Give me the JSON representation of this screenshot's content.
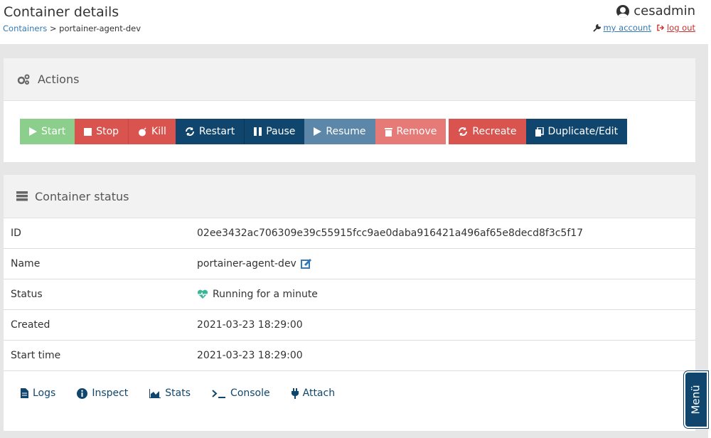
{
  "header": {
    "title": "Container details",
    "breadcrumb": {
      "parent": "Containers",
      "separator": ">",
      "current": "portainer-agent-dev"
    },
    "user": {
      "name": "cesadmin",
      "my_account": "my account",
      "log_out": "log out"
    }
  },
  "actions": {
    "title": "Actions",
    "buttons": {
      "start": "Start",
      "stop": "Stop",
      "kill": "Kill",
      "restart": "Restart",
      "pause": "Pause",
      "resume": "Resume",
      "remove": "Remove",
      "recreate": "Recreate",
      "duplicate": "Duplicate/Edit"
    }
  },
  "status": {
    "title": "Container status",
    "rows": [
      {
        "key": "ID",
        "value": "02ee3432ac706309e39c55915fcc9ae0daba916421a496af65e8decd8f3c5f17"
      },
      {
        "key": "Name",
        "value": "portainer-agent-dev"
      },
      {
        "key": "Status",
        "value": "Running for a minute"
      },
      {
        "key": "Created",
        "value": "2021-03-23 18:29:00"
      },
      {
        "key": "Start time",
        "value": "2021-03-23 18:29:00"
      }
    ],
    "links": {
      "logs": "Logs",
      "inspect": "Inspect",
      "stats": "Stats",
      "console": "Console",
      "attach": "Attach"
    }
  },
  "menu_tab": "Menü",
  "colors": {
    "primary": "#10466d",
    "danger": "#d9534f",
    "success": "#8ccf8c",
    "info": "#5c87a8",
    "link": "#337ab7",
    "status_heart": "#3cb497"
  }
}
